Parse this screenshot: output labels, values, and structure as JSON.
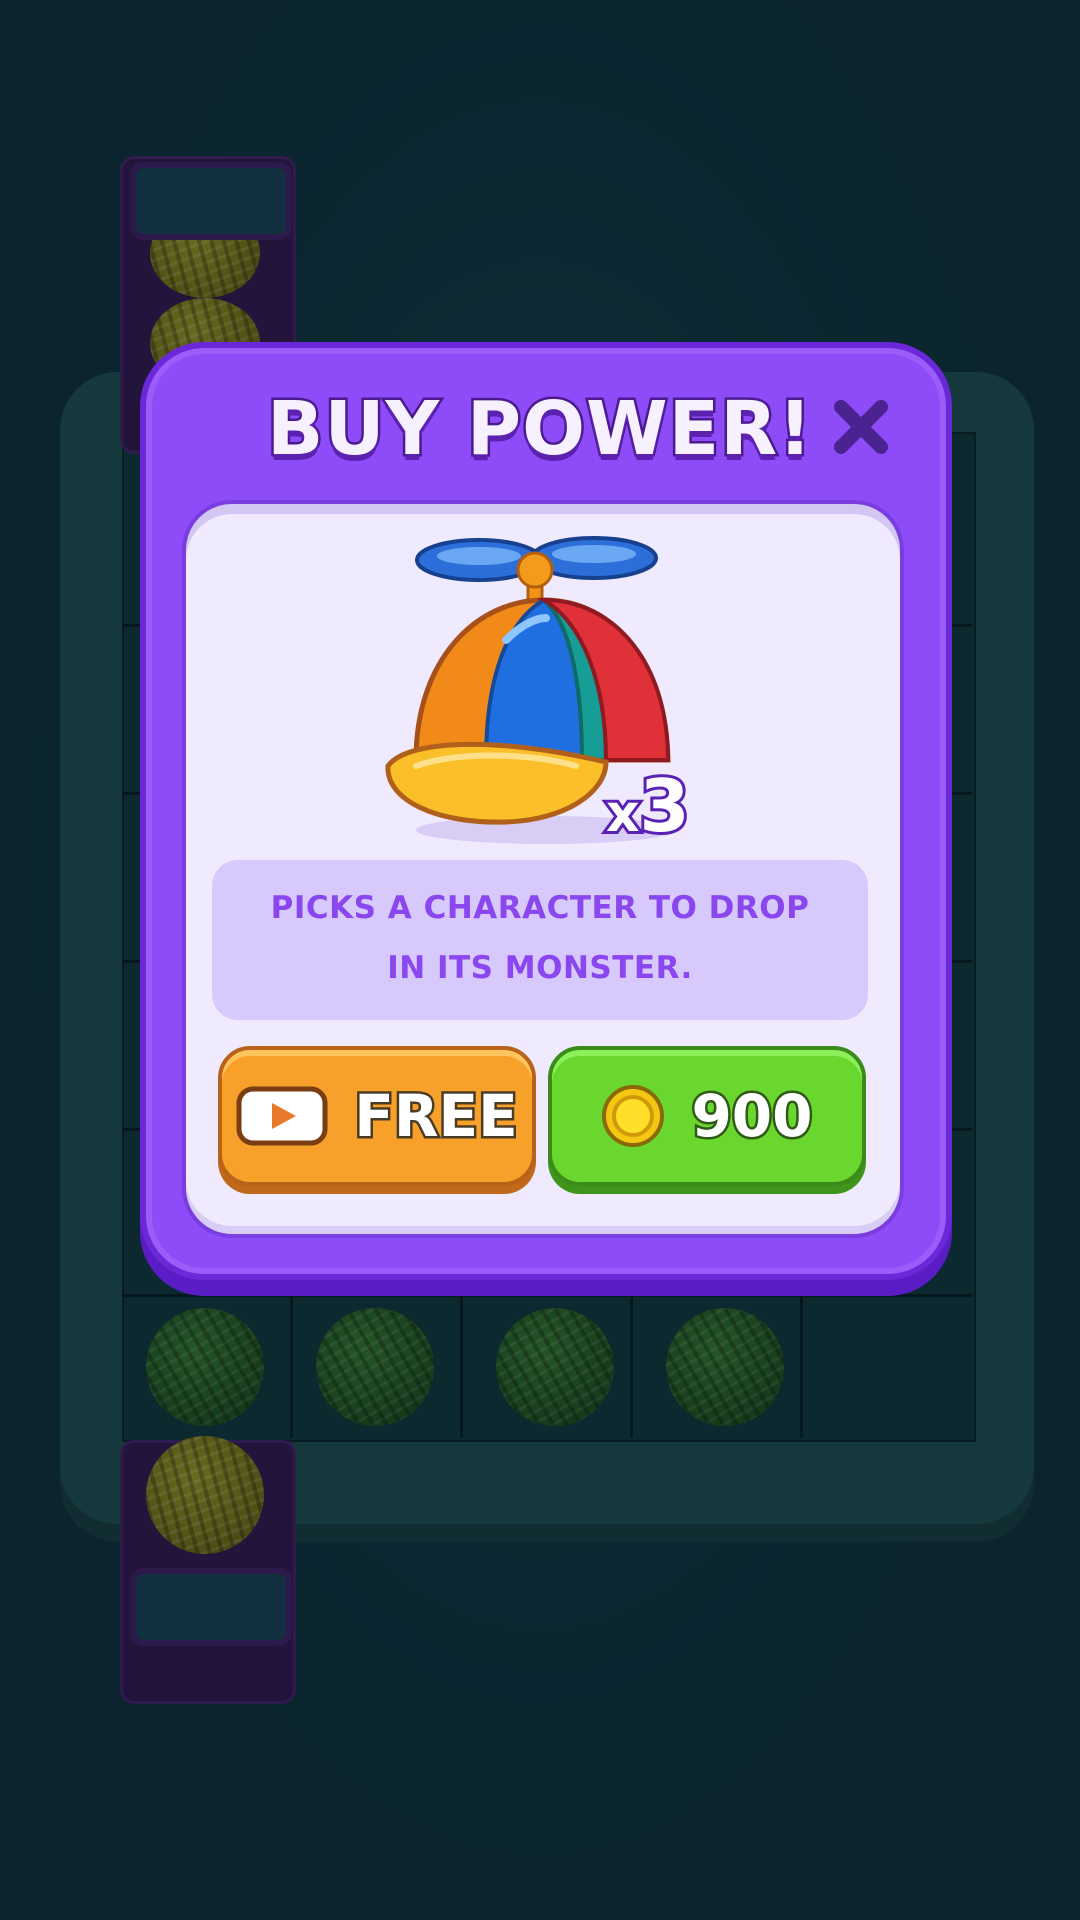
{
  "modal": {
    "title": "BUY POWER!",
    "power_item": "propeller-cap",
    "quantity_prefix": "x",
    "quantity": "3",
    "description_line1": "PICKS A CHARACTER TO DROP",
    "description_line2": "IN ITS MONSTER.",
    "free_button_label": "FREE",
    "coin_button_label": "900",
    "close_icon": "close-icon",
    "video_icon": "play-video-icon",
    "coin_icon": "coin-icon"
  },
  "colors": {
    "background": "#0c2a33",
    "modal_purple": "#8d4cf7",
    "card_bg": "#efeafd",
    "description_text": "#8a47ef",
    "free_button": "#f7a12a",
    "coin_button": "#6ad72f"
  },
  "board": {
    "yarn_colors": [
      "green",
      "green",
      "green",
      "green",
      "yellow"
    ]
  }
}
